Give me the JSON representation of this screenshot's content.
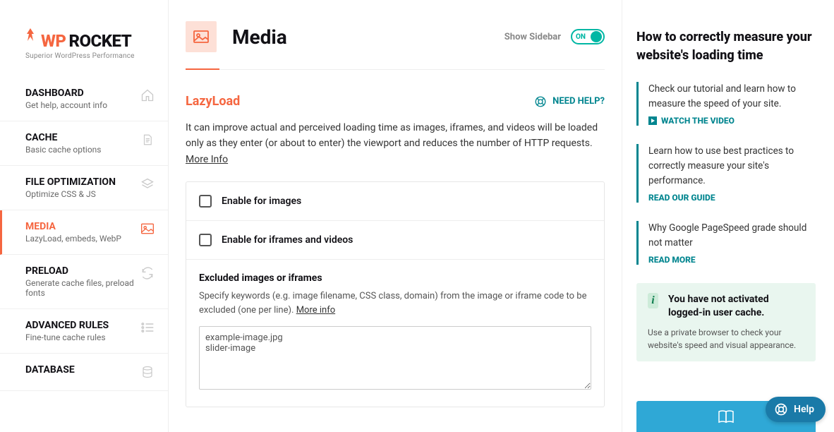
{
  "logo": {
    "wp": "WP",
    "rocket": "ROCKET",
    "sub": "Superior WordPress Performance"
  },
  "nav": [
    {
      "title": "DASHBOARD",
      "sub": "Get help, account info",
      "icon": "home"
    },
    {
      "title": "CACHE",
      "sub": "Basic cache options",
      "icon": "file"
    },
    {
      "title": "FILE OPTIMIZATION",
      "sub": "Optimize CSS & JS",
      "icon": "layers"
    },
    {
      "title": "MEDIA",
      "sub": "LazyLoad, embeds, WebP",
      "icon": "image"
    },
    {
      "title": "PRELOAD",
      "sub": "Generate cache files, preload fonts",
      "icon": "refresh"
    },
    {
      "title": "ADVANCED RULES",
      "sub": "Fine-tune cache rules",
      "icon": "sliders"
    },
    {
      "title": "DATABASE",
      "sub": "",
      "icon": "database"
    }
  ],
  "header": {
    "title": "Media",
    "toggle_label": "Show Sidebar",
    "toggle_on": "ON"
  },
  "section": {
    "title": "LazyLoad",
    "help": "NEED HELP?",
    "desc": "It can improve actual and perceived loading time as images, iframes, and videos will be loaded only as they enter (or about to enter) the viewport and reduces the number of HTTP requests. ",
    "more_info": "More Info",
    "opt1": "Enable for images",
    "opt2": "Enable for iframes and videos",
    "excl_title": "Excluded images or iframes",
    "excl_desc": "Specify keywords (e.g. image filename, CSS class, domain) from the image or iframe code to be excluded (one per line). ",
    "excl_more": "More info",
    "excl_value": "example-image.jpg\nslider-image"
  },
  "right": {
    "title": "How to correctly measure your website's loading time",
    "cards": [
      {
        "text": "Check our tutorial and learn how to measure the speed of your site.",
        "link": "WATCH THE VIDEO",
        "video": true
      },
      {
        "text": "Learn how to use best practices to correctly measure your site's performance.",
        "link": "READ OUR GUIDE",
        "video": false
      },
      {
        "text": "Why Google PageSpeed grade should not matter",
        "link": "READ MORE",
        "video": false
      }
    ],
    "info_msg": "You have not activated logged-in user cache.",
    "info_sub": "Use a private browser to check your website's speed and visual appearance."
  },
  "help_fab": "Help"
}
